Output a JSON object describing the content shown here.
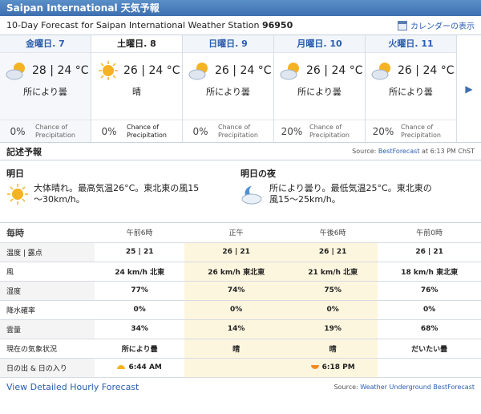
{
  "header": {
    "title": "Saipan International 天気予報"
  },
  "subhead": {
    "title": "10-Day Forecast for Saipan International Weather Station",
    "station": "96950",
    "calendar_label": "カレンダーの表示"
  },
  "days": [
    {
      "name": "金曜日. 7",
      "hi": "28",
      "lo": "24",
      "unit": "°C",
      "cond": "所により曇",
      "precip": "0%",
      "icon": "partly-cloudy-icon"
    },
    {
      "name": "土曜日. 8",
      "hi": "26",
      "lo": "24",
      "unit": "°C",
      "cond": "晴",
      "precip": "0%",
      "icon": "sunny-icon"
    },
    {
      "name": "日曜日. 9",
      "hi": "26",
      "lo": "24",
      "unit": "°C",
      "cond": "所により曇",
      "precip": "0%",
      "icon": "partly-cloudy-icon"
    },
    {
      "name": "月曜日. 10",
      "hi": "26",
      "lo": "24",
      "unit": "°C",
      "cond": "所により曇",
      "precip": "20%",
      "icon": "partly-cloudy-icon"
    },
    {
      "name": "火曜日. 11",
      "hi": "26",
      "lo": "24",
      "unit": "°C",
      "cond": "所により曇",
      "precip": "20%",
      "icon": "partly-cloudy-icon"
    }
  ],
  "chance_label_1": "Chance of",
  "chance_label_2": "Precipitation",
  "narrative": {
    "title": "記述予報",
    "source_prefix": "Source: ",
    "source_link": "BestForecast",
    "source_suffix": " at 6:13 PM ChST",
    "day": {
      "title": "明日",
      "text": "大体晴れ。最高気温26°C。東北東の風15～30km/h。"
    },
    "night": {
      "title": "明日の夜",
      "text": "所により曇り。最低気温25°C。東北東の風15～25km/h。"
    }
  },
  "hourly": {
    "header_label": "毎時",
    "times": [
      "午前6時",
      "正午",
      "午後6時",
      "午前0時"
    ],
    "rows": [
      {
        "label": "温度 | 露点",
        "values": [
          "25 | 21",
          "26 | 21",
          "26 | 21",
          "26 | 21"
        ]
      },
      {
        "label": "風",
        "values": [
          "24 km/h 北東",
          "26 km/h 東北東",
          "21 km/h 北東",
          "18 km/h 東北東"
        ]
      },
      {
        "label": "湿度",
        "values": [
          "77%",
          "74%",
          "75%",
          "76%"
        ]
      },
      {
        "label": "降水確率",
        "values": [
          "0%",
          "0%",
          "0%",
          "0%"
        ]
      },
      {
        "label": "雲量",
        "values": [
          "34%",
          "14%",
          "19%",
          "68%"
        ]
      },
      {
        "label": "現在の気象状況",
        "values": [
          "所により曇",
          "晴",
          "晴",
          "だいたい曇"
        ]
      },
      {
        "label": "日の出 & 日の入り",
        "values": [
          "6:44 AM",
          "",
          "6:18 PM",
          ""
        ]
      }
    ]
  },
  "footer": {
    "link": "View Detailed Hourly Forecast",
    "source_prefix": "Source: ",
    "source_link": "Weather Underground BestForecast"
  },
  "colors": {
    "accent": "#3d6fb0",
    "highlight": "#fdf6df",
    "sun": "#f5b324",
    "sunset": "#f08a24"
  }
}
